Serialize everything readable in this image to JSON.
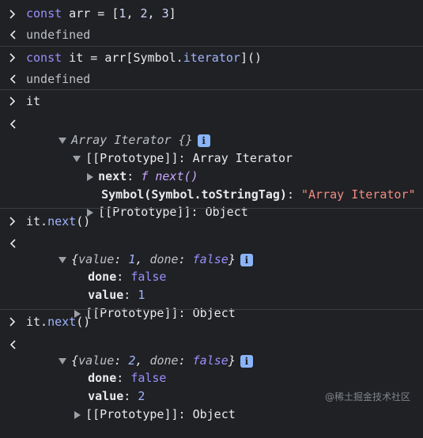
{
  "colors": {
    "background": "#202124",
    "separator": "#3c3d40",
    "keyword": "#9a8fff",
    "number": "#9fb4ff",
    "string": "#f28b82"
  },
  "entries": [
    {
      "input_parts": [
        "const",
        " arr = [",
        "1",
        ", ",
        "2",
        ", ",
        "3",
        "]"
      ],
      "output": "undefined"
    },
    {
      "input_parts": [
        "const",
        " it = arr[Symbol.",
        "iterator",
        "]()"
      ],
      "output": "undefined"
    },
    {
      "input": "it",
      "result_title": "Array Iterator {}",
      "proto_label": "[[Prototype]]: Array Iterator",
      "next_key": "next",
      "next_value": "f next()",
      "symbol_key": "Symbol(Symbol.toStringTag)",
      "symbol_value": "\"Array Iterator\"",
      "proto2_label": "[[Prototype]]: Object"
    },
    {
      "input_parts": [
        "it.",
        "next",
        "()"
      ],
      "summary_parts": [
        "{",
        "value",
        ": ",
        "1",
        ", ",
        "done",
        ": ",
        "false",
        "}"
      ],
      "done_key": "done",
      "done_value": "false",
      "value_key": "value",
      "value_value": "1",
      "proto_label": "[[Prototype]]: Object"
    },
    {
      "input_parts": [
        "it.",
        "next",
        "()"
      ],
      "summary_parts": [
        "{",
        "value",
        ": ",
        "2",
        ", ",
        "done",
        ": ",
        "false",
        "}"
      ],
      "done_key": "done",
      "done_value": "false",
      "value_key": "value",
      "value_value": "2",
      "proto_label": "[[Prototype]]: Object"
    }
  ],
  "info_badge": "i",
  "watermark": "@稀土掘金技术社区"
}
